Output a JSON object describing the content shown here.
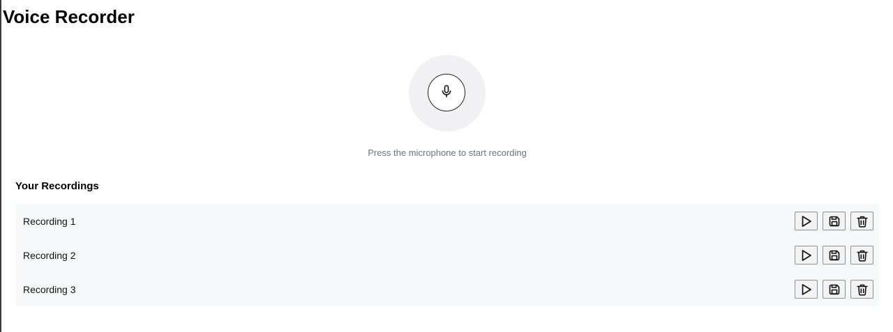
{
  "app": {
    "title": "Voice Recorder"
  },
  "recorder": {
    "mic_icon": "microphone-icon",
    "hint": "Press the microphone to start recording"
  },
  "recordings": {
    "heading": "Your Recordings",
    "items": [
      {
        "label": "Recording 1"
      },
      {
        "label": "Recording 2"
      },
      {
        "label": "Recording 3"
      }
    ],
    "action_icons": [
      "play-icon",
      "save-icon",
      "trash-icon"
    ]
  }
}
